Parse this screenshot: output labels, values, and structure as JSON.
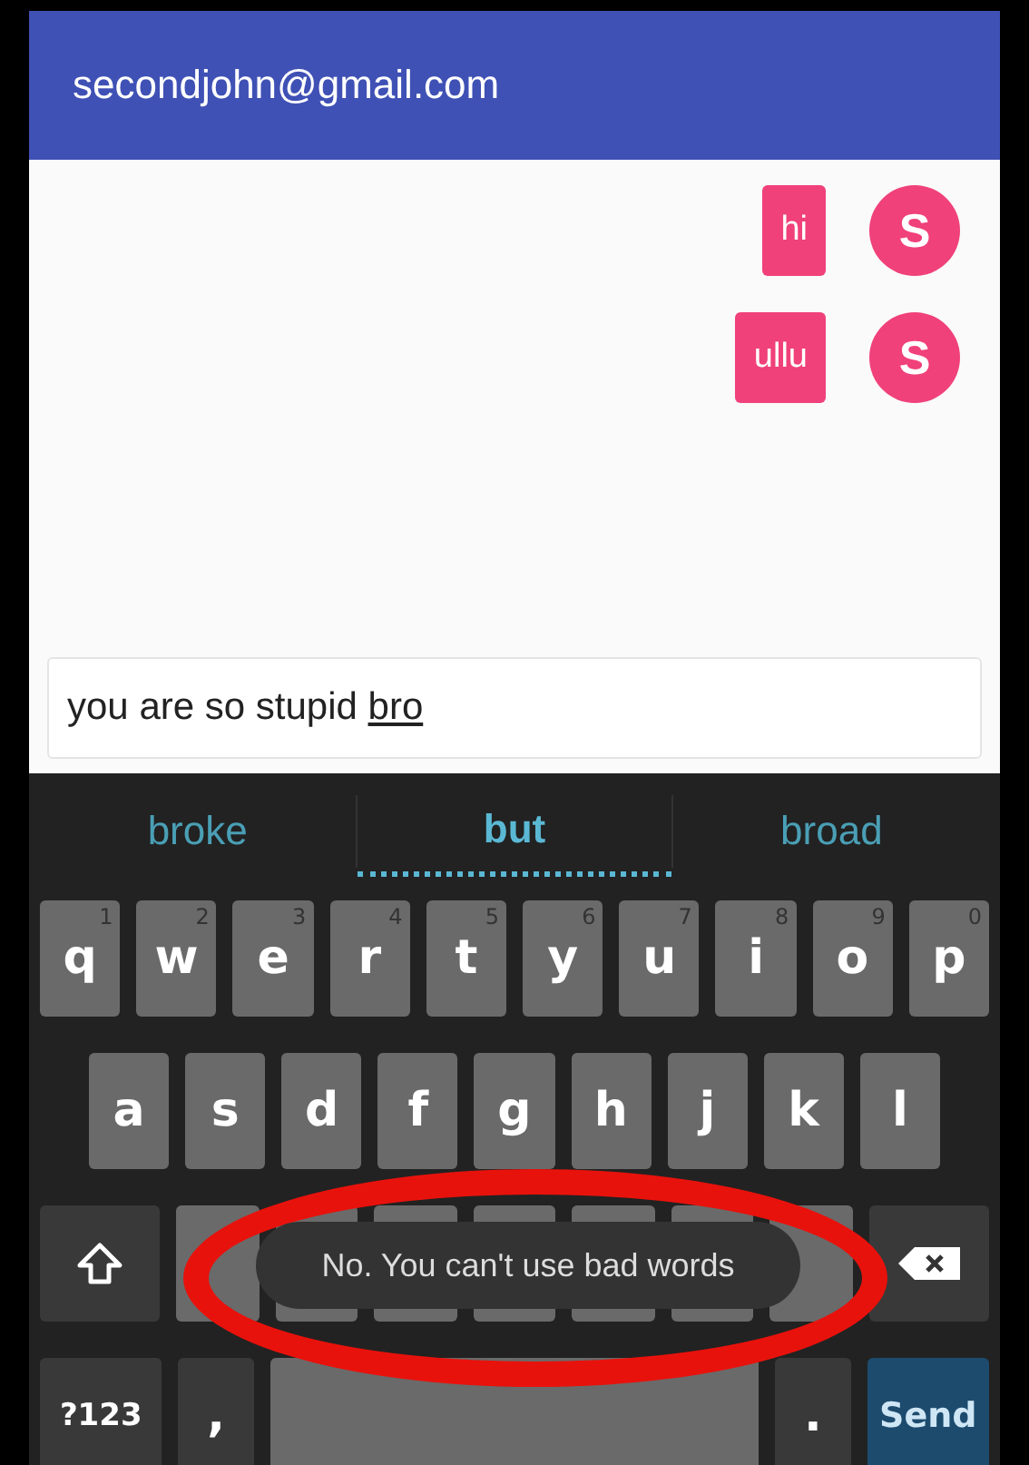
{
  "header": {
    "title": "secondjohn@gmail.com"
  },
  "messages": [
    {
      "text": "hi",
      "avatar": "S"
    },
    {
      "text": "ullu",
      "avatar": "S"
    }
  ],
  "composer": {
    "value": "you are so stupid ",
    "composing": "bro"
  },
  "suggestions": [
    {
      "label": "broke",
      "selected": false
    },
    {
      "label": "but",
      "selected": true
    },
    {
      "label": "broad",
      "selected": false
    }
  ],
  "keyboard": {
    "rows": [
      {
        "keys": [
          {
            "kind": "char",
            "label": "q",
            "hint": "1"
          },
          {
            "kind": "char",
            "label": "w",
            "hint": "2"
          },
          {
            "kind": "char",
            "label": "e",
            "hint": "3"
          },
          {
            "kind": "char",
            "label": "r",
            "hint": "4"
          },
          {
            "kind": "char",
            "label": "t",
            "hint": "5"
          },
          {
            "kind": "char",
            "label": "y",
            "hint": "6"
          },
          {
            "kind": "char",
            "label": "u",
            "hint": "7"
          },
          {
            "kind": "char",
            "label": "i",
            "hint": "8"
          },
          {
            "kind": "char",
            "label": "o",
            "hint": "9"
          },
          {
            "kind": "char",
            "label": "p",
            "hint": "0"
          }
        ]
      },
      {
        "keys": [
          {
            "kind": "char",
            "label": "a"
          },
          {
            "kind": "char",
            "label": "s"
          },
          {
            "kind": "char",
            "label": "d"
          },
          {
            "kind": "char",
            "label": "f"
          },
          {
            "kind": "char",
            "label": "g"
          },
          {
            "kind": "char",
            "label": "h"
          },
          {
            "kind": "char",
            "label": "j"
          },
          {
            "kind": "char",
            "label": "k"
          },
          {
            "kind": "char",
            "label": "l"
          }
        ]
      },
      {
        "keys": [
          {
            "kind": "shift"
          },
          {
            "kind": "blank"
          },
          {
            "kind": "blank"
          },
          {
            "kind": "blank"
          },
          {
            "kind": "blank"
          },
          {
            "kind": "blank"
          },
          {
            "kind": "blank"
          },
          {
            "kind": "blank"
          },
          {
            "kind": "backspace"
          }
        ]
      },
      {
        "keys": [
          {
            "kind": "symbols",
            "label": "?123"
          },
          {
            "kind": "punct",
            "label": ","
          },
          {
            "kind": "space"
          },
          {
            "kind": "punct",
            "label": "."
          },
          {
            "kind": "action",
            "label": "Send"
          }
        ]
      }
    ]
  },
  "toast": {
    "text": "No. You can't use bad words",
    "highlighted": true
  }
}
